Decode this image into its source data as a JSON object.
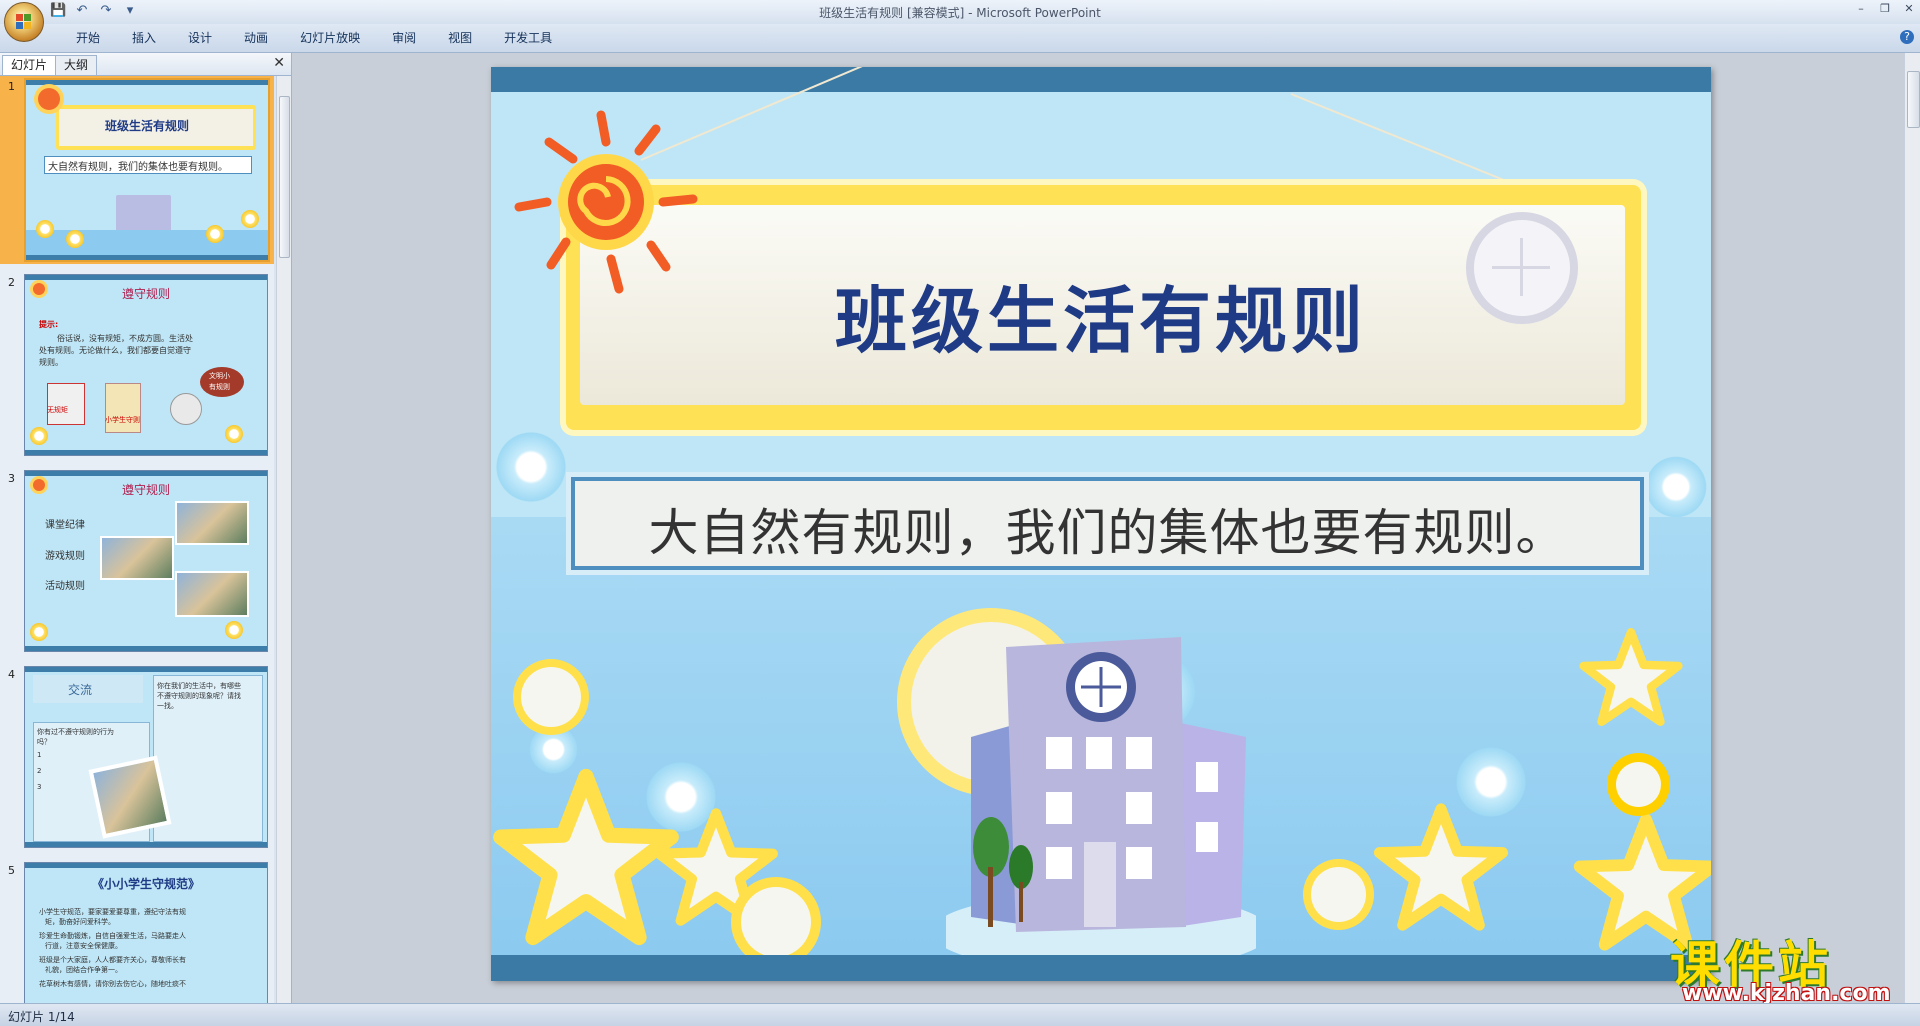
{
  "window": {
    "title": "班级生活有规则 [兼容模式] - Microsoft PowerPoint"
  },
  "quick_access": {
    "icons": [
      "save-icon",
      "undo-icon",
      "redo-icon",
      "customize-icon"
    ]
  },
  "ribbon": {
    "tabs": [
      "开始",
      "插入",
      "设计",
      "动画",
      "幻灯片放映",
      "审阅",
      "视图",
      "开发工具"
    ]
  },
  "left_pane": {
    "tabs": [
      "幻灯片",
      "大纲"
    ],
    "slides": [
      {
        "number": "1",
        "title": "班级生活有规则",
        "lines": [
          "大自然有规则，我们的集体也要有规则。"
        ]
      },
      {
        "number": "2",
        "title": "遵守规则",
        "lines": [
          "提示:",
          "俗话说，没有规矩，不成方圆。生活处",
          "处有规则。无论做什么，我们都要自觉遵守",
          "规则。",
          "无规矩",
          "小学生守则",
          "文明小",
          "有规则"
        ]
      },
      {
        "number": "3",
        "title": "遵守规则",
        "lines": [
          "课堂纪律",
          "游戏规则",
          "活动规则"
        ]
      },
      {
        "number": "4",
        "title": "交流",
        "lines": [
          "你在我们的生活中，有哪些",
          "不遵守规则的现象呢？请找",
          "一找。",
          "你有过不遵守规则的行为",
          "吗？",
          "1",
          "2",
          "3"
        ]
      },
      {
        "number": "5",
        "title": "《小小学生守规范》",
        "lines": [
          "小学生守规范，要家要爱要尊重，遵纪守法有规",
          "矩，勤奋好问爱科学。",
          "珍爱生命勤锻炼，自信自强爱生活，马路要走人",
          "行道，注意安全保健康。",
          "班级是个大家庭，人人都要齐关心，尊敬师长有",
          "礼貌，团结合作争第一。",
          "花草树木有感情，请你别去伤它心，随地吐痰不"
        ]
      }
    ]
  },
  "slide": {
    "title": "班级生活有规则",
    "subtitle": "大自然有规则，我们的集体也要有规则。"
  },
  "watermark": {
    "big": "课件站",
    "small": "www.kjzhan.com"
  },
  "status": {
    "slide_indicator": "幻灯片 1/14"
  },
  "colors": {
    "slide_band": "#3a7aa5",
    "title_text": "#1f3b86",
    "board_yellow": "#ffe156",
    "thumb_selected": "#f8b24a"
  }
}
